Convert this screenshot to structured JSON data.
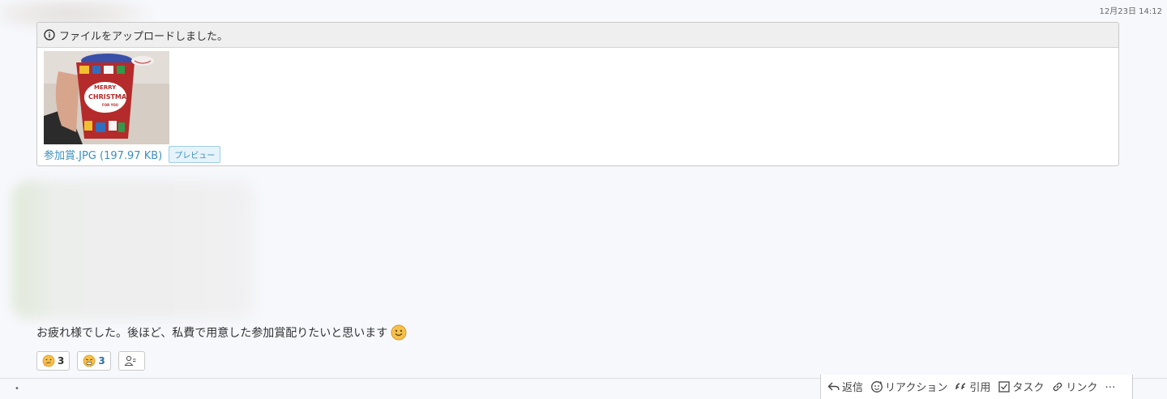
{
  "message_header": {
    "timestamp": "12月23日 14:12"
  },
  "upload": {
    "notice": "ファイルをアップロードしました。",
    "thumbnail": {
      "text_line1": "MERRY",
      "text_line2": "CHRISTMAS",
      "text_line3": "FOR YOU"
    },
    "file_name": "参加賞.JPG (197.97 KB)",
    "preview_label": "プレビュー"
  },
  "message": {
    "text": "お疲れ様でした。後ほど、私費で用意した参加賞配りたいと思います",
    "emoji": "smile-emoji"
  },
  "reactions": [
    {
      "icon": "thinking-emoji-icon",
      "count": "3"
    },
    {
      "icon": "tired-emoji-icon",
      "count": "3"
    },
    {
      "icon": "user-add-icon",
      "count": ""
    }
  ],
  "actions": {
    "reply": "返信",
    "reaction": "リアクション",
    "quote": "引用",
    "task": "タスク",
    "link": "リンク",
    "more": "…"
  },
  "colors": {
    "link": "#3a8fbf",
    "background": "#f7f8fc",
    "card_border": "#c9c9c9"
  }
}
